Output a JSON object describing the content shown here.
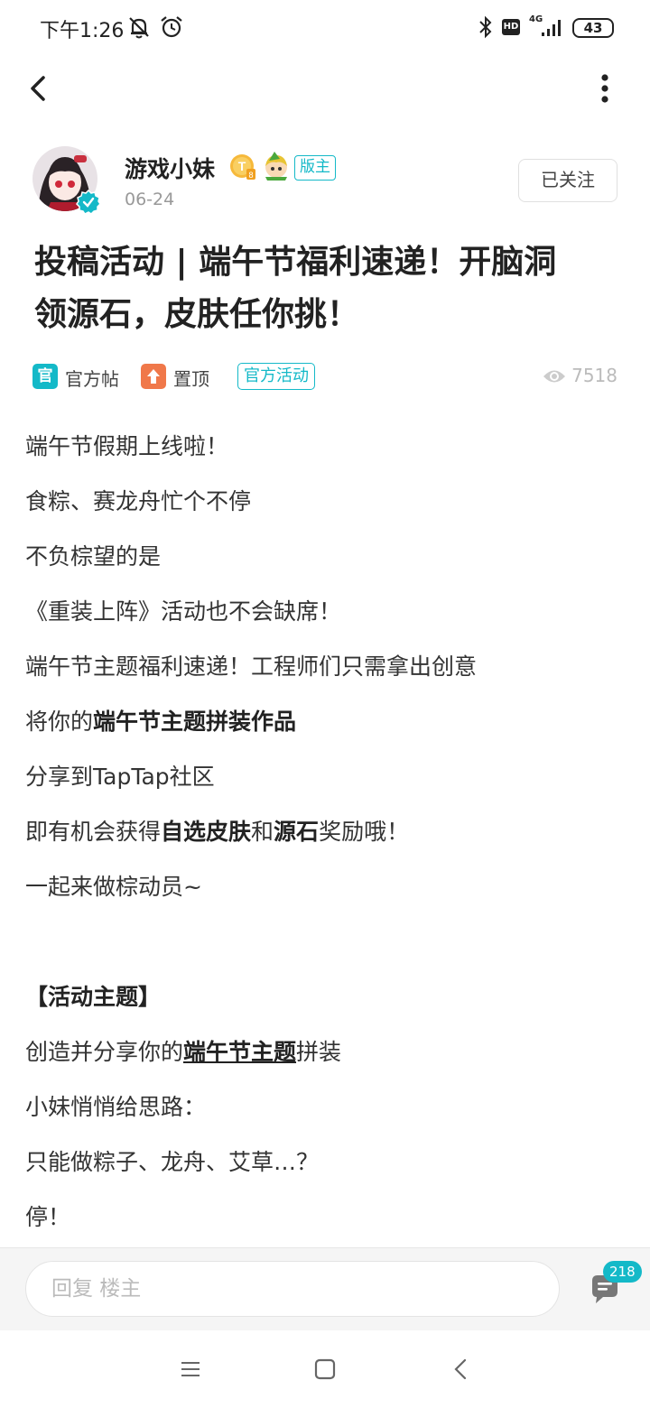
{
  "status_bar": {
    "time": "下午1:26",
    "network": "4G",
    "hd": "HD",
    "battery": "43"
  },
  "toolbar": {
    "back_icon": "chevron-left-icon",
    "more_icon": "more-vertical-icon"
  },
  "author": {
    "name": "游戏小妹",
    "role_tag": "版主",
    "date": "06-24",
    "follow_label": "已关注",
    "level_badge": "T",
    "level_sub": "8"
  },
  "post": {
    "title_line1": "投稿活动 | 端午节福利速递！开脑洞",
    "title_line2": "领源石，皮肤任你挑！",
    "official_icon": "官",
    "official_label": "官方帖",
    "pinned_label": "置顶",
    "event_tag": "官方活动",
    "views": "7518"
  },
  "content": {
    "l1": "端午节假期上线啦！",
    "l2": "食粽、赛龙舟忙个不停",
    "l3": "不负棕望的是",
    "l4": "《重装上阵》活动也不会缺席！",
    "l5": "端午节主题福利速递！工程师们只需拿出创意",
    "l6a": "将你的",
    "l6b": "端午节主题拼装作品",
    "l7": "分享到TapTap社区",
    "l8a": "即有机会获得",
    "l8b": "自选皮肤",
    "l8c": "和",
    "l8d": "源石",
    "l8e": "奖励哦！",
    "l9": "一起来做棕动员~",
    "section": "【活动主题】",
    "l11a": "创造并分享你的",
    "l11b": "端午节主题",
    "l11c": "拼装",
    "l12": "小妹悄悄给思路：",
    "l13": "只能做粽子、龙舟、艾草…？",
    "l14": "停！"
  },
  "reply_bar": {
    "placeholder": "回复  楼主",
    "comment_count": "218"
  },
  "colors": {
    "accent": "#14b9c8",
    "pinned": "#f0784a"
  }
}
